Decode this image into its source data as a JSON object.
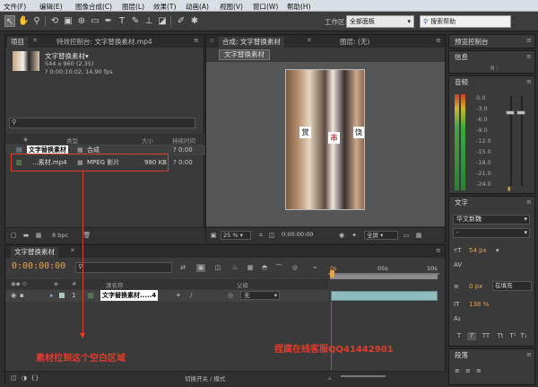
{
  "menu": [
    "文件(F)",
    "编辑(E)",
    "图像合成(C)",
    "图层(L)",
    "效果(T)",
    "动画(A)",
    "视图(V)",
    "窗口(W)",
    "帮助(H)"
  ],
  "toolbar": {
    "workspace_label": "工作区:",
    "workspace_value": "全部面板",
    "help_placeholder": "搜索帮助"
  },
  "project_panel": {
    "tab_project": "项目",
    "tab_effect": "特效控制台: 文字替换素材.mp4",
    "preview_name": "文字替换素材▾",
    "preview_size": "544 x 960 (2.35)",
    "preview_info": "? 0:00:10:02, 14.90 fps",
    "col_type": "类型",
    "col_size": "大小",
    "col_duration": "持续时间",
    "items": [
      {
        "name": "文字替换素材",
        "type": "合成",
        "size": "",
        "duration": "? 0:00"
      },
      {
        "name": "...素材.mp4",
        "type": "MPEG 影片",
        "size": "980 KB",
        "duration": "? 0:00"
      }
    ],
    "bpc": "8 bpc"
  },
  "comp_panel": {
    "tab_comp": "合成: 文字替换素材",
    "tab_layer": "图层: (无)",
    "comp_tab": "文字替换素材",
    "zoom": "25 %",
    "timecode": "0:00:00:00",
    "resolution": "全屏",
    "cards": [
      "赏",
      "串",
      "饶"
    ]
  },
  "preview_panel": {
    "tab": "预览控制台"
  },
  "info_panel": {
    "tab": "信息",
    "r_label": "R :"
  },
  "audio_panel": {
    "tab": "音频",
    "scale": [
      "0.0",
      "-3.0",
      "-6.0",
      "-9.0",
      "-12.0",
      "-15.0",
      "-18.0",
      "-21.0",
      "-24.0"
    ],
    "right_scale": [
      "12.0 dB",
      "0.0 dB",
      "-12.0",
      "-24.0"
    ]
  },
  "character_panel": {
    "tab": "文字",
    "font": "华文新魏",
    "style": "-",
    "font_size": "54 px",
    "leading": "px",
    "tracking": "",
    "stroke_w": "0 px",
    "stroke_mode": "在填充",
    "v_scale": "138 %",
    "h_scale": "%",
    "baseline": "px",
    "t_buttons": [
      "T",
      "T",
      "TT",
      "Tt",
      "T¹",
      "T₁"
    ]
  },
  "paragraph_panel": {
    "tab": "段落"
  },
  "timeline": {
    "tab": "文字替换素材",
    "timecode": "0:00:00:00",
    "search_placeholder": "",
    "ruler": [
      "0s",
      "05s",
      "10s"
    ],
    "col_source": "源名称",
    "col_parent": "父级",
    "layer_index": "1",
    "layer_name": "文字替换素材.....4",
    "parent_value": "无",
    "toggle_label": "切换开关 / 模式"
  },
  "annotations": {
    "left": "素材拉到这个空白区域",
    "right": "捏腐在线客服QQ41442901"
  },
  "colors": {
    "accent_orange": "#e8a04a",
    "annotation_red": "#e23c2c",
    "track_teal": "#8fbcbf"
  }
}
